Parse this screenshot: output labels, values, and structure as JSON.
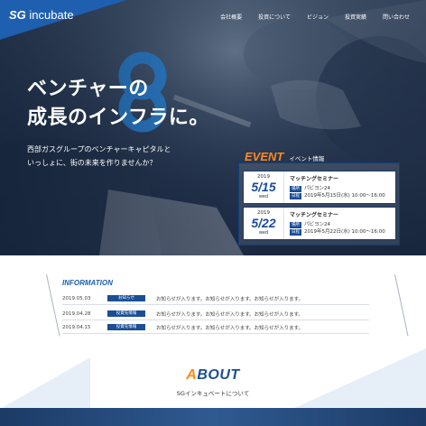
{
  "brand": {
    "logo_bold": "SG",
    "logo_rest": " incubate"
  },
  "nav": {
    "items": [
      "会社概要",
      "投資について",
      "ビジョン",
      "投資実績",
      "問い合わせ"
    ]
  },
  "hero": {
    "headline_line1": "ベンチャーの",
    "headline_line2": "成長のインフラに。",
    "sub_line1": "西部ガスグループのベンチャーキャピタルと",
    "sub_line2": "いっしょに、街の未来を作りませんか？"
  },
  "event": {
    "title": "EVENT",
    "subtitle": "イベント情報",
    "cards": [
      {
        "year": "2019",
        "date": "5/15",
        "weekday": "wed",
        "name": "マッチングセミナー",
        "place_tag": "場所",
        "place": "パビヨン24",
        "date_tag": "日程",
        "when": "2019年5月15日(水) 10:00～16:00"
      },
      {
        "year": "2019",
        "date": "5/22",
        "weekday": "wed",
        "name": "マッチングセミナー",
        "place_tag": "場所",
        "place": "パビヨン24",
        "date_tag": "日程",
        "when": "2019年5月22日(水) 10:00～16:00"
      }
    ]
  },
  "information": {
    "title": "INFORMATION",
    "rows": [
      {
        "date": "2019.05.03",
        "category": "お知らせ",
        "text": "お知らせが入ります。お知らせが入ります。お知らせが入ります。"
      },
      {
        "date": "2019.04.28",
        "category": "投資先情報",
        "text": "お知らせが入ります。お知らせが入ります。お知らせが入ります。"
      },
      {
        "date": "2019.04.15",
        "category": "投資先情報",
        "text": "お知らせが入ります。お知らせが入ります。お知らせが入ります。"
      }
    ]
  },
  "about": {
    "title_first": "A",
    "title_rest": "BOUT",
    "subtitle": "SGインキュベートについて"
  },
  "colors": {
    "accent": "#ff8a1d",
    "brand_blue": "#1a4e96",
    "hero_dark": "#1d2c44"
  }
}
